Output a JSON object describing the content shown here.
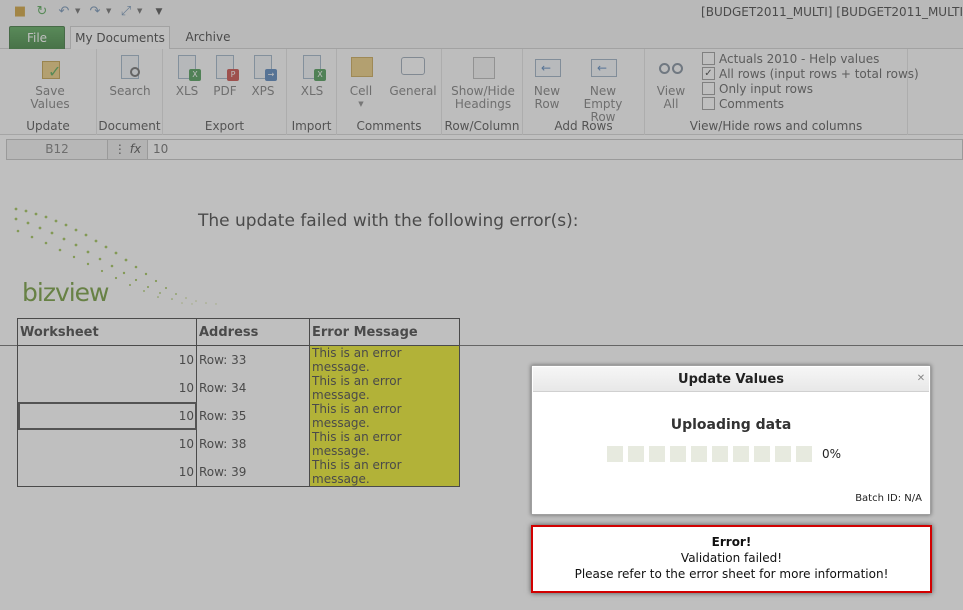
{
  "window": {
    "title": "[BUDGET2011_MULTI] [BUDGET2011_MULTI"
  },
  "tabs": [
    {
      "label": "File"
    },
    {
      "label": "My Documents"
    },
    {
      "label": "Archive"
    }
  ],
  "ribbon": {
    "update": {
      "save_values": "Save Values",
      "group": "Update"
    },
    "document": {
      "search": "Search",
      "group": "Document"
    },
    "export": {
      "xls": "XLS",
      "pdf": "PDF",
      "xps": "XPS",
      "group": "Export"
    },
    "import": {
      "xls": "XLS",
      "group": "Import"
    },
    "comments": {
      "cell": "Cell",
      "general": "General",
      "group": "Comments"
    },
    "rowcolumn": {
      "show_hide": "Show/Hide Headings",
      "group": "Row/Column"
    },
    "addrows": {
      "new_row": "New Row",
      "new_empty_row": "New Empty Row",
      "group": "Add Rows"
    },
    "viewhide": {
      "view_all": "View All",
      "group": "View/Hide rows and columns",
      "options": [
        {
          "label": "Actuals 2010 - Help values",
          "checked": false
        },
        {
          "label": "All rows (input rows + total rows)",
          "checked": true
        },
        {
          "label": "Only input rows",
          "checked": false
        },
        {
          "label": "Comments",
          "checked": false
        }
      ]
    }
  },
  "formula_bar": {
    "cell_ref": "B12",
    "fx": "fx",
    "value": "10"
  },
  "sheet": {
    "heading": "The update failed with the following error(s):",
    "logo_text": "bizview",
    "table": {
      "headers": [
        "Worksheet",
        "Address",
        "Error Message"
      ],
      "rows": [
        {
          "worksheet": "10",
          "address": "Row: 33",
          "message": "This is an error message."
        },
        {
          "worksheet": "10",
          "address": "Row: 34",
          "message": "This is an error message."
        },
        {
          "worksheet": "10",
          "address": "Row: 35",
          "message": "This is an error message."
        },
        {
          "worksheet": "10",
          "address": "Row: 38",
          "message": "This is an error message."
        },
        {
          "worksheet": "10",
          "address": "Row: 39",
          "message": "This is an error message."
        }
      ]
    }
  },
  "dialog": {
    "title": "Update Values",
    "status": "Uploading data",
    "progress_percent": 0,
    "progress_label": "0%",
    "segments": 10,
    "batch_id": "Batch ID: N/A"
  },
  "error_toast": {
    "title": "Error!",
    "line1": "Validation failed!",
    "line2": "Please refer to the error sheet for more information!"
  },
  "colors": {
    "file_tab": "#2e852e",
    "error_highlight": "#e6e600",
    "toast_border": "#d20000",
    "logo_green": "#5a8a1a"
  }
}
